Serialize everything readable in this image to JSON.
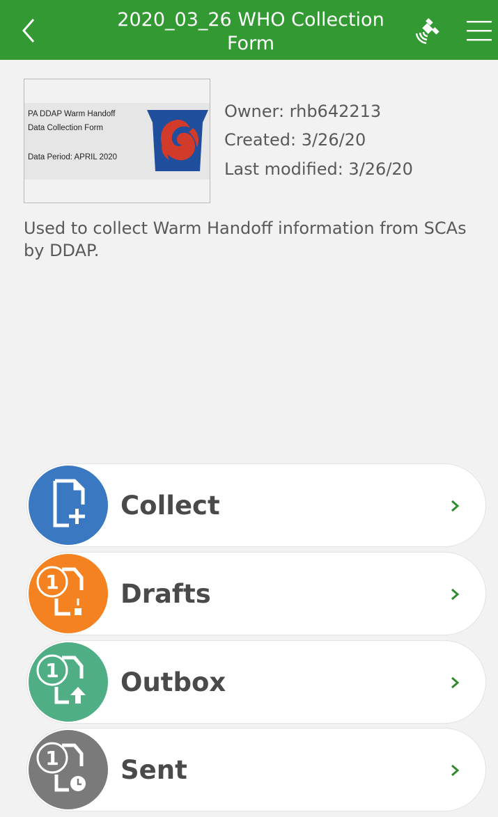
{
  "header": {
    "title": "2020_03_26 WHO Collection Form",
    "background_color": "#339933",
    "back_icon": "chevron-left-icon",
    "gps_icon": "satellite-icon",
    "menu_icon": "hamburger-menu-icon"
  },
  "thumbnail": {
    "line1": "PA DDAP Warm Handoff",
    "line2": "Data Collection Form",
    "line3": "Data Period:   APRIL 2020",
    "logo_icon": "keystone-phoenix-logo"
  },
  "info": {
    "owner": "Owner: rhb642213",
    "created": "Created: 3/26/20",
    "modified": "Last modified: 3/26/20",
    "description": "Used to collect Warm Handoff information from SCAs by DDAP."
  },
  "menu": [
    {
      "label": "Collect",
      "color": "#3a78c2",
      "icon": "new-document-icon"
    },
    {
      "label": "Drafts",
      "color": "#f58220",
      "icon": "drafts-icon",
      "badge": "1"
    },
    {
      "label": "Outbox",
      "color": "#4fae84",
      "icon": "outbox-icon",
      "badge": "1"
    },
    {
      "label": "Sent",
      "color": "#7a7a7a",
      "icon": "sent-icon",
      "badge": "1"
    }
  ],
  "chevron_color": "#2e8b2e"
}
